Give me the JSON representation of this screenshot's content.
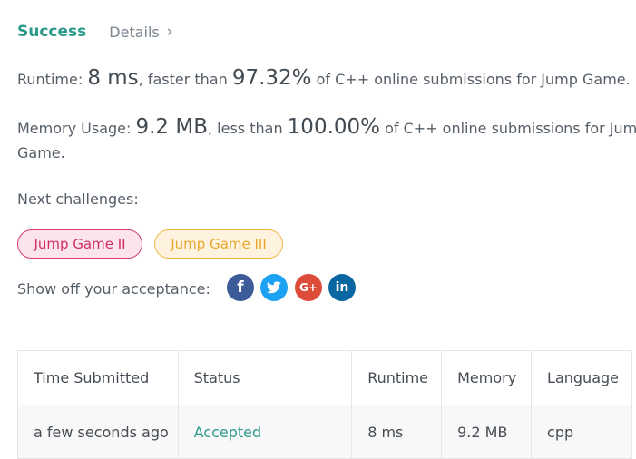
{
  "result": {
    "status": "Success",
    "details_label": "Details",
    "details_chevron": "›"
  },
  "runtime": {
    "label": "Runtime: ",
    "value": "8 ms",
    "middle": ", faster than ",
    "percent": "97.32%",
    "suffix": " of C++ online submissions for Jump Game."
  },
  "memory": {
    "label": "Memory Usage: ",
    "value": "9.2 MB",
    "middle": ", less than ",
    "percent": "100.00%",
    "suffix": " of C++ online submissions for Jump",
    "suffix_line2": "Game."
  },
  "next": {
    "label": "Next challenges:",
    "challenges": [
      {
        "label": "Jump Game II",
        "difficulty": "hard",
        "color": "#d12d63"
      },
      {
        "label": "Jump Game III",
        "difficulty": "medium",
        "color": "#e8a62c"
      }
    ]
  },
  "share": {
    "label": "Show off your acceptance:",
    "icons": [
      {
        "name": "facebook-icon",
        "glyph": "f",
        "color": "#3d5b98"
      },
      {
        "name": "twitter-icon",
        "glyph": "t",
        "color": "#1da1f2"
      },
      {
        "name": "google-plus-icon",
        "glyph": "G+",
        "color": "#dd4b39"
      },
      {
        "name": "linkedin-icon",
        "glyph": "in",
        "color": "#0a66a0"
      }
    ]
  },
  "table": {
    "headers": [
      "Time Submitted",
      "Status",
      "Runtime",
      "Memory",
      "Language"
    ],
    "rows": [
      [
        "a few seconds ago",
        "Accepted",
        "8 ms",
        "9.2 MB",
        "cpp"
      ]
    ]
  },
  "colors": {
    "accent": "#2c9a8b",
    "text": "#555e67"
  }
}
